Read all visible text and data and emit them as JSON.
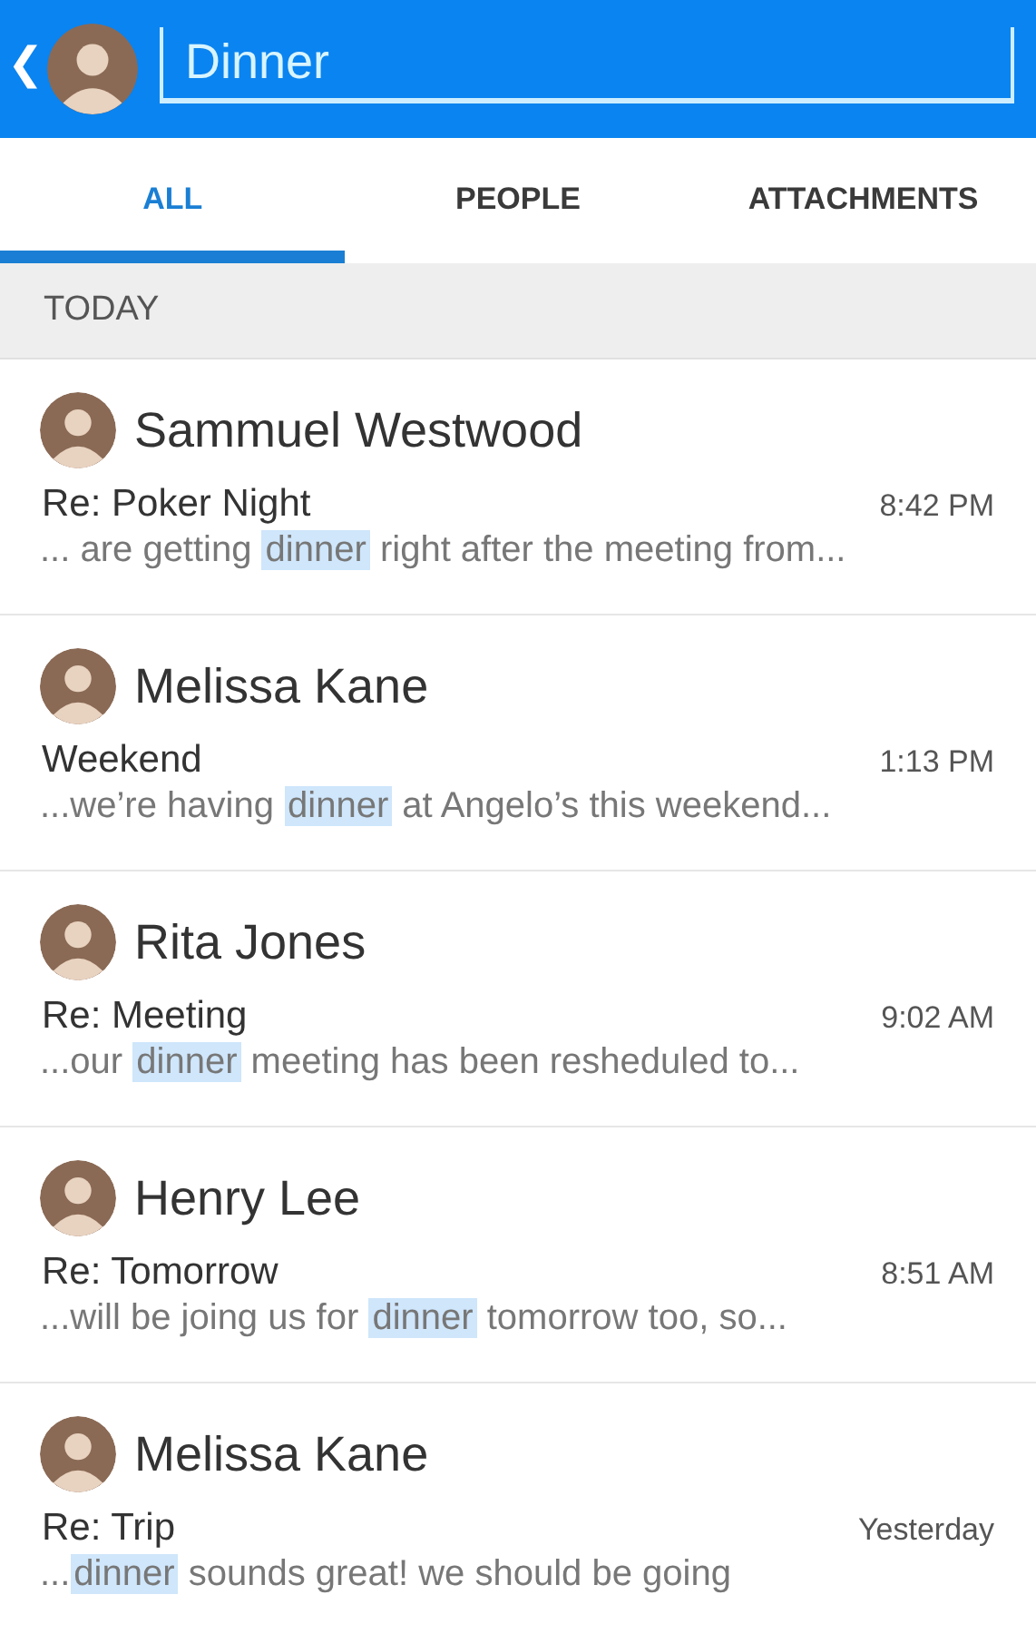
{
  "header": {
    "back": "❮",
    "search_value": "Dinner"
  },
  "tabs": [
    {
      "label": "ALL",
      "selected": true
    },
    {
      "label": "PEOPLE",
      "selected": false
    },
    {
      "label": "ATTACHMENTS",
      "selected": false
    }
  ],
  "section": "TODAY",
  "messages": [
    {
      "sender": "Sammuel Westwood",
      "subject": "Re: Poker Night",
      "time": "8:42 PM",
      "snippet": {
        "before": "... are getting ",
        "match": "dinner",
        "after": " right after the meeting from..."
      }
    },
    {
      "sender": "Melissa Kane",
      "subject": "Weekend",
      "time": "1:13 PM",
      "snippet": {
        "before": "...we’re having ",
        "match": "dinner",
        "after": " at Angelo’s this weekend..."
      }
    },
    {
      "sender": "Rita Jones",
      "subject": "Re: Meeting",
      "time": "9:02 AM",
      "snippet": {
        "before": "...our ",
        "match": "dinner",
        "after": " meeting has been resheduled to..."
      }
    },
    {
      "sender": "Henry Lee",
      "subject": "Re: Tomorrow",
      "time": "8:51 AM",
      "snippet": {
        "before": "...will be joing us for ",
        "match": "dinner",
        "after": " tomorrow too, so..."
      }
    },
    {
      "sender": "Melissa Kane",
      "subject": "Re: Trip",
      "time": "Yesterday",
      "snippet": {
        "before": "...",
        "match": "dinner",
        "after": " sounds great! we should be going"
      }
    }
  ]
}
